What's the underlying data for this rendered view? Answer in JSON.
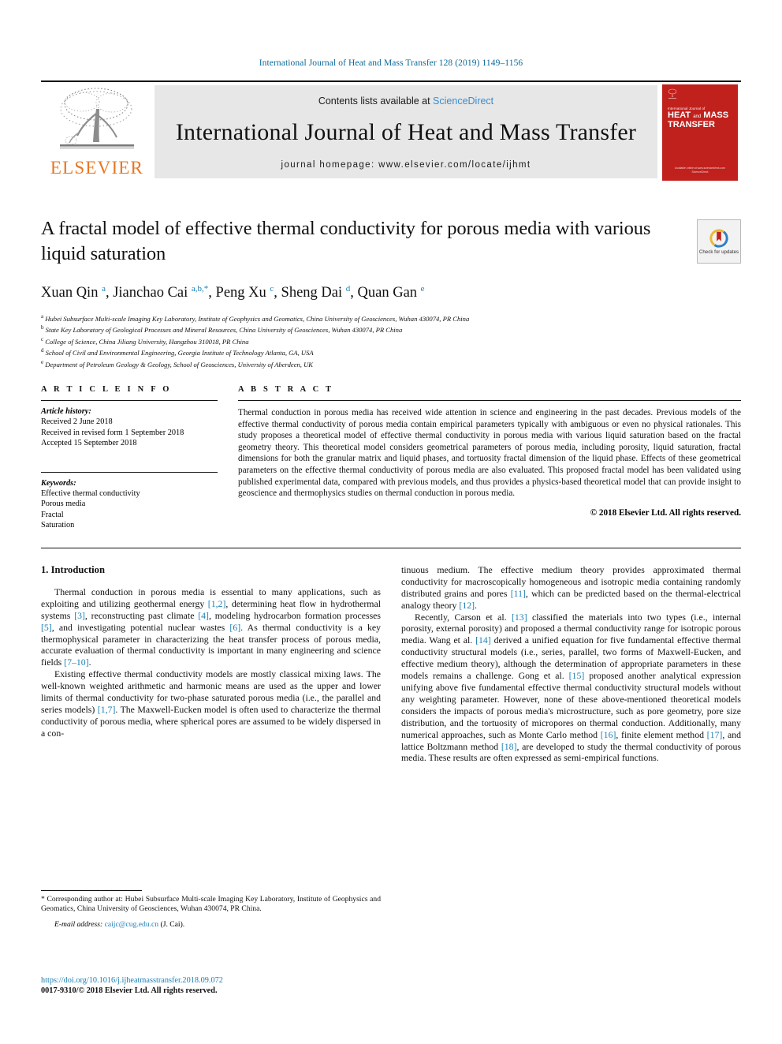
{
  "running_head": "International Journal of Heat and Mass Transfer 128 (2019) 1149–1156",
  "banner": {
    "publisher_name": "ELSEVIER",
    "contents_prefix": "Contents lists available at ",
    "sciencedirect": "ScienceDirect",
    "journal_title": "International Journal of Heat and Mass Transfer",
    "homepage": "journal homepage: www.elsevier.com/locate/ijhmt",
    "cover": {
      "kicker": "International Journal of",
      "line1": "HEAT",
      "line1_small": "and",
      "line1b": "MASS",
      "line2": "TRANSFER",
      "foot1": "Available online at www.sciencedirect.com",
      "foot2": "ScienceDirect"
    }
  },
  "article": {
    "title": "A fractal model of effective thermal conductivity for porous media with various liquid saturation",
    "crossmark_label": "Check for updates",
    "authors_html": "Xuan Qin <sup>a</sup>, Jianchao Cai <sup>a,b,</sup><sup>*</sup>, Peng Xu <sup>c</sup>, Sheng Dai <sup>d</sup>, Quan Gan <sup>e</sup>",
    "affiliations": [
      {
        "mark": "a",
        "text": "Hubei Subsurface Multi-scale Imaging Key Laboratory, Institute of Geophysics and Geomatics, China University of Geosciences, Wuhan 430074, PR China"
      },
      {
        "mark": "b",
        "text": "State Key Laboratory of Geological Processes and Mineral Resources, China University of Geosciences, Wuhan 430074, PR China"
      },
      {
        "mark": "c",
        "text": "College of Science, China Jiliang University, Hangzhou 310018, PR China"
      },
      {
        "mark": "d",
        "text": "School of Civil and Environmental Engineering, Georgia Institute of Technology Atlanta, GA, USA"
      },
      {
        "mark": "e",
        "text": "Department of Petroleum Geology & Geology, School of Geosciences, University of Aberdeen, UK"
      }
    ]
  },
  "article_info": {
    "heading": "A R T I C L E   I N F O",
    "history_label": "Article history:",
    "history": [
      "Received 2 June 2018",
      "Received in revised form 1 September 2018",
      "Accepted 15 September 2018"
    ],
    "keywords_label": "Keywords:",
    "keywords": [
      "Effective thermal conductivity",
      "Porous media",
      "Fractal",
      "Saturation"
    ]
  },
  "abstract": {
    "heading": "A B S T R A C T",
    "text": "Thermal conduction in porous media has received wide attention in science and engineering in the past decades. Previous models of the effective thermal conductivity of porous media contain empirical parameters typically with ambiguous or even no physical rationales. This study proposes a theoretical model of effective thermal conductivity in porous media with various liquid saturation based on the fractal geometry theory. This theoretical model considers geometrical parameters of porous media, including porosity, liquid saturation, fractal dimensions for both the granular matrix and liquid phases, and tortuosity fractal dimension of the liquid phase. Effects of these geometrical parameters on the effective thermal conductivity of porous media are also evaluated. This proposed fractal model has been validated using published experimental data, compared with previous models, and thus provides a physics-based theoretical model that can provide insight to geoscience and thermophysics studies on thermal conduction in porous media.",
    "copyright": "© 2018 Elsevier Ltd. All rights reserved."
  },
  "body": {
    "section_heading": "1. Introduction",
    "left_paragraphs": [
      "Thermal conduction in porous media is essential to many applications, such as exploiting and utilizing geothermal energy [1,2], determining heat flow in hydrothermal systems [3], reconstructing past climate [4], modeling hydrocarbon formation processes [5], and investigating potential nuclear wastes [6]. As thermal conductivity is a key thermophysical parameter in characterizing the heat transfer process of porous media, accurate evaluation of thermal conductivity is important in many engineering and science fields [7–10].",
      "Existing effective thermal conductivity models are mostly classical mixing laws. The well-known weighted arithmetic and harmonic means are used as the upper and lower limits of thermal conductivity for two-phase saturated porous media (i.e., the parallel and series models) [1,7]. The Maxwell-Eucken model is often used to characterize the thermal conductivity of porous media, where spherical pores are assumed to be widely dispersed in a con-"
    ],
    "right_paragraphs": [
      "tinuous medium. The effective medium theory provides approximated thermal conductivity for macroscopically homogeneous and isotropic media containing randomly distributed grains and pores [11], which can be predicted based on the thermal-electrical analogy theory [12].",
      "Recently, Carson et al. [13] classified the materials into two types (i.e., internal porosity, external porosity) and proposed a thermal conductivity range for isotropic porous media. Wang et al. [14] derived a unified equation for five fundamental effective thermal conductivity structural models (i.e., series, parallel, two forms of Maxwell-Eucken, and effective medium theory), although the determination of appropriate parameters in these models remains a challenge. Gong et al. [15] proposed another analytical expression unifying above five fundamental effective thermal conductivity structural models without any weighting parameter. However, none of these above-mentioned theoretical models considers the impacts of porous media's microstructure, such as pore geometry, pore size distribution, and the tortuosity of micropores on thermal conduction. Additionally, many numerical approaches, such as Monte Carlo method [16], finite element method [17], and lattice Boltzmann method [18], are developed to study the thermal conductivity of porous media. These results are often expressed as semi-empirical functions."
    ]
  },
  "footnotes": {
    "corresponding": "* Corresponding author at: Hubei Subsurface Multi-scale Imaging Key Laboratory, Institute of Geophysics and Geomatics, China University of Geosciences, Wuhan 430074, PR China.",
    "email_label": "E-mail address:",
    "email": "caijc@cug.edu.cn",
    "email_owner": "(J. Cai).",
    "doi": "https://doi.org/10.1016/j.ijheatmasstransfer.2018.09.072",
    "issn": "0017-9310/© 2018 Elsevier Ltd. All rights reserved."
  },
  "colors": {
    "link_blue": "#1a7fb5",
    "elsevier_orange": "#e87722",
    "cover_red": "#c0211d",
    "banner_gray": "#e7e7e7"
  }
}
